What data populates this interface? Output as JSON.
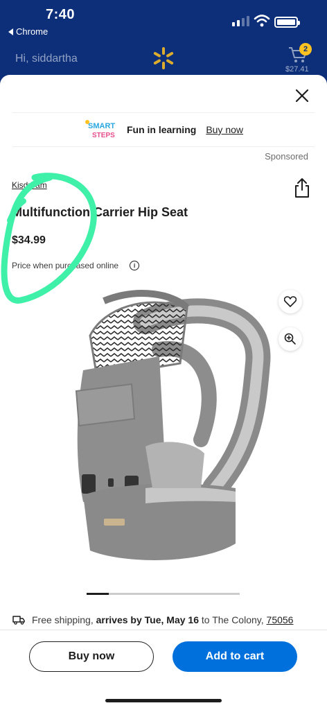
{
  "status_bar": {
    "time": "7:40",
    "back_app": "Chrome"
  },
  "header": {
    "greeting": "Hi, siddartha",
    "cart_count": "2",
    "cart_total": "$27.41"
  },
  "ad": {
    "brand_logo_text": "SMART STEPS",
    "text": "Fun in learning",
    "link": "Buy now",
    "sponsored": "Sponsored"
  },
  "product": {
    "brand": "Kisdream",
    "title": "Multifunction Carrier Hip Seat",
    "price": "$34.99",
    "price_note": "Price when purchased online"
  },
  "gallery": {
    "active_index": 1,
    "image_alt": "gray baby carrier with hip seat"
  },
  "shipping": {
    "prefix": "Free shipping,",
    "arrives": "arrives by Tue, May 16",
    "to": "to The Colony,",
    "zip": "75056"
  },
  "actions": {
    "buy_now": "Buy now",
    "add_to_cart": "Add to cart"
  },
  "colors": {
    "header_bg": "#0d2f7a",
    "walmart_yellow": "#ffc220",
    "primary_blue": "#0071dc",
    "annotation_green": "#3ef0a8"
  },
  "icons": [
    "close-icon",
    "share-icon",
    "heart-icon",
    "zoom-icon",
    "truck-icon",
    "info-icon",
    "spark-logo-icon",
    "cart-icon"
  ]
}
